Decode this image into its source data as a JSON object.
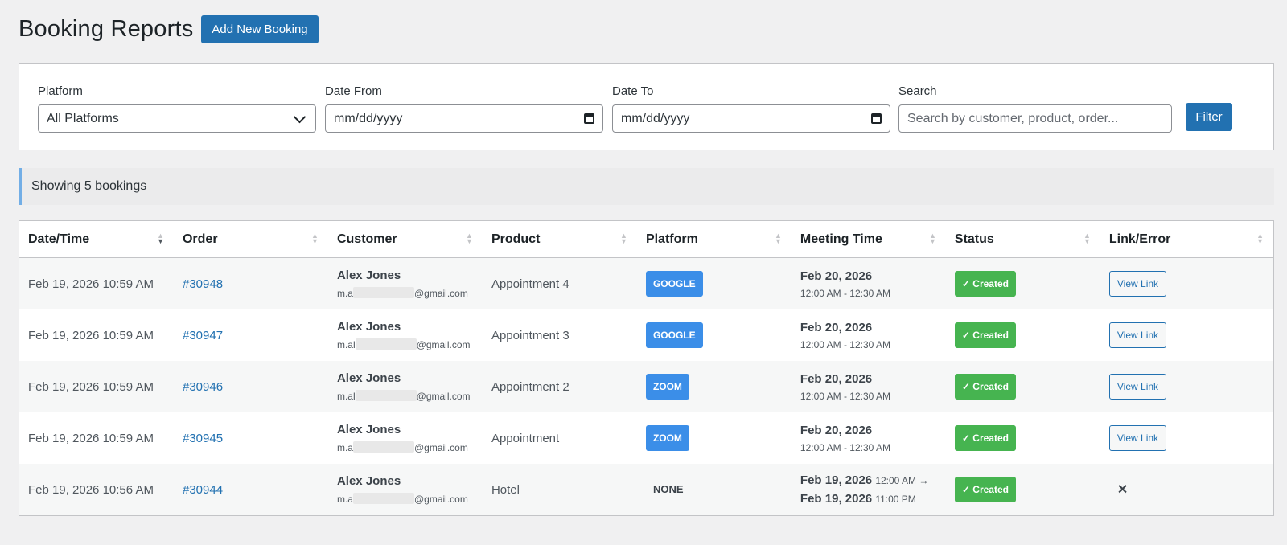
{
  "header": {
    "title": "Booking Reports",
    "add_button": "Add New Booking"
  },
  "filters": {
    "platform": {
      "label": "Platform",
      "value": "All Platforms"
    },
    "date_from": {
      "label": "Date From",
      "placeholder": "mm/dd/yyyy"
    },
    "date_to": {
      "label": "Date To",
      "placeholder": "mm/dd/yyyy"
    },
    "search": {
      "label": "Search",
      "placeholder": "Search by customer, product, order..."
    },
    "filter_button": "Filter"
  },
  "notice": "Showing 5 bookings",
  "table": {
    "columns": [
      "Date/Time",
      "Order",
      "Customer",
      "Product",
      "Platform",
      "Meeting Time",
      "Status",
      "Link/Error"
    ],
    "rows": [
      {
        "datetime": "Feb 19, 2026 10:59 AM",
        "order": "#30948",
        "customer": "Alex Jones",
        "email_prefix": "m.a",
        "email_suffix": "@gmail.com",
        "product": "Appointment 4",
        "platform": "GOOGLE",
        "meeting_date": "Feb 20, 2026",
        "meeting_time": "12:00 AM - 12:30 AM",
        "status": "✓ Created",
        "link": "View Link"
      },
      {
        "datetime": "Feb 19, 2026 10:59 AM",
        "order": "#30947",
        "customer": "Alex Jones",
        "email_prefix": "m.al",
        "email_suffix": "@gmail.com",
        "product": "Appointment 3",
        "platform": "GOOGLE",
        "meeting_date": "Feb 20, 2026",
        "meeting_time": "12:00 AM - 12:30 AM",
        "status": "✓ Created",
        "link": "View Link"
      },
      {
        "datetime": "Feb 19, 2026 10:59 AM",
        "order": "#30946",
        "customer": "Alex Jones",
        "email_prefix": "m.al",
        "email_suffix": "@gmail.com",
        "product": "Appointment 2",
        "platform": "ZOOM",
        "meeting_date": "Feb 20, 2026",
        "meeting_time": "12:00 AM - 12:30 AM",
        "status": "✓ Created",
        "link": "View Link"
      },
      {
        "datetime": "Feb 19, 2026 10:59 AM",
        "order": "#30945",
        "customer": "Alex Jones",
        "email_prefix": "m.a",
        "email_suffix": "@gmail.com",
        "product": "Appointment",
        "platform": "ZOOM",
        "meeting_date": "Feb 20, 2026",
        "meeting_time": "12:00 AM - 12:30 AM",
        "status": "✓ Created",
        "link": "View Link"
      },
      {
        "datetime": "Feb 19, 2026 10:56 AM",
        "order": "#30944",
        "customer": "Alex Jones",
        "email_prefix": "m.a",
        "email_suffix": "@gmail.com",
        "product": "Hotel",
        "platform": "NONE",
        "meeting_start_date": "Feb 19, 2026",
        "meeting_start_time": "12:00 AM →",
        "meeting_end_date": "Feb 19, 2026",
        "meeting_end_time": "11:00 PM",
        "status": "✓ Created",
        "error": "✕"
      }
    ]
  },
  "colors": {
    "accent": "#2271b1",
    "badge_blue": "#3b8ee8",
    "status_green": "#46b450"
  }
}
